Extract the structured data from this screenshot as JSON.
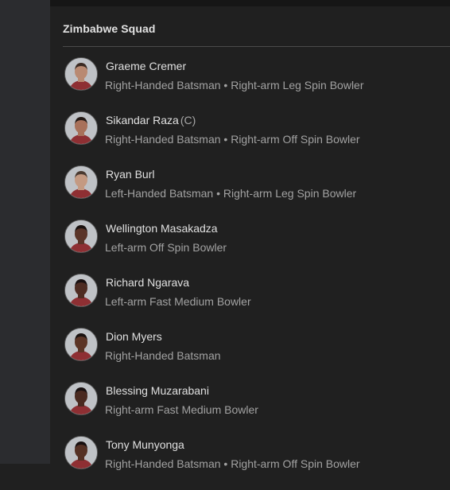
{
  "squad": {
    "title": "Zimbabwe Squad",
    "players": [
      {
        "name": "Graeme Cremer",
        "captain": "",
        "role": "Right-Handed Batsman • Right-arm Leg Spin Bowler",
        "skin": "#b98a72",
        "hair": "#3a2a22",
        "shirt": "#8e2f33"
      },
      {
        "name": "Sikandar Raza",
        "captain": "(C)",
        "role": "Right-Handed Batsman • Right-arm Off Spin Bowler",
        "skin": "#a8715a",
        "hair": "#241a16",
        "shirt": "#8e2f33"
      },
      {
        "name": "Ryan Burl",
        "captain": "",
        "role": "Left-Handed Batsman • Right-arm Leg Spin Bowler",
        "skin": "#c49a82",
        "hair": "#4a3a30",
        "shirt": "#8e2f33"
      },
      {
        "name": "Wellington Masakadza",
        "captain": "",
        "role": "Left-arm Off Spin Bowler",
        "skin": "#5a3428",
        "hair": "#1a1210",
        "shirt": "#8e2f33"
      },
      {
        "name": "Richard Ngarava",
        "captain": "",
        "role": "Left-arm Fast Medium Bowler",
        "skin": "#4e2c22",
        "hair": "#181010",
        "shirt": "#8e2f33"
      },
      {
        "name": "Dion Myers",
        "captain": "",
        "role": "Right-Handed Batsman",
        "skin": "#5c3526",
        "hair": "#1a1210",
        "shirt": "#8e2f33"
      },
      {
        "name": "Blessing Muzarabani",
        "captain": "",
        "role": "Right-arm Fast Medium Bowler",
        "skin": "#4a2a20",
        "hair": "#181010",
        "shirt": "#8e2f33"
      },
      {
        "name": "Tony Munyonga",
        "captain": "",
        "role": "Right-Handed Batsman • Right-arm Off Spin Bowler",
        "skin": "#553124",
        "hair": "#181010",
        "shirt": "#8e2f33"
      }
    ]
  }
}
